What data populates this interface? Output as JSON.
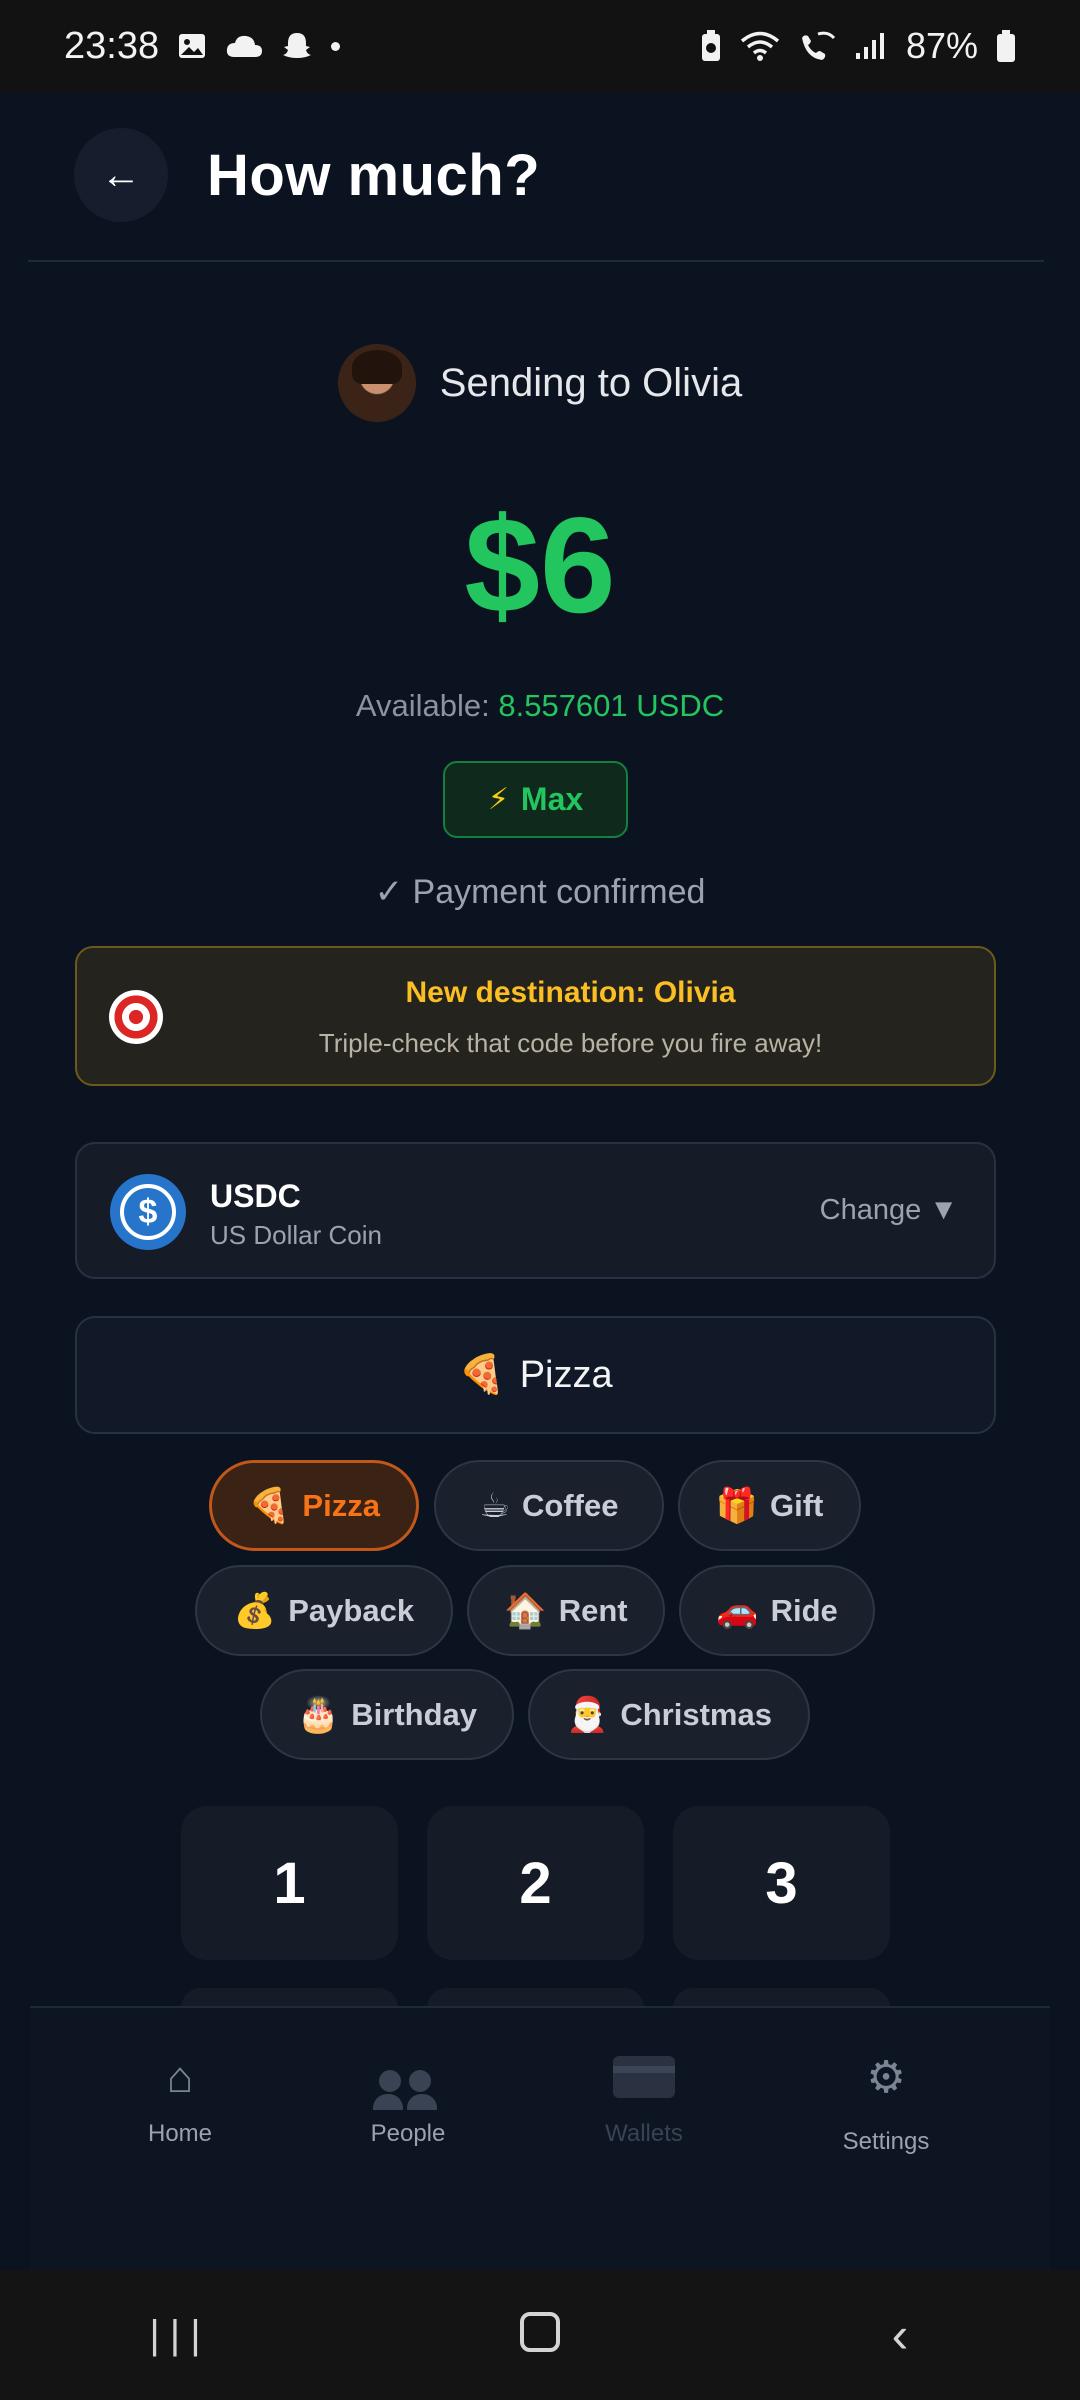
{
  "status_bar": {
    "time": "23:38",
    "battery": "87%",
    "left_icons": [
      "gallery-icon",
      "cloud-icon",
      "snapchat-icon",
      "dot-icon"
    ],
    "right_icons": [
      "battery-saver-icon",
      "wifi-icon",
      "wifi-calling-icon",
      "signal-icon",
      "battery-icon"
    ]
  },
  "header": {
    "back_icon": "←",
    "title": "How much?"
  },
  "recipient": {
    "label": "Sending to Olivia"
  },
  "amount": {
    "value": "$6",
    "available_label": "Available:",
    "available_value": "8.557601 USDC",
    "max_label": "Max",
    "max_icon": "⚡",
    "confirmed_text": "✓ Payment confirmed",
    "accent_color": "#22c55e"
  },
  "banner": {
    "icon": "target-icon",
    "title": "New destination: Olivia",
    "subtitle": "Triple-check that code before you fire away!"
  },
  "token": {
    "symbol": "USDC",
    "name": "US Dollar Coin",
    "change_label": "Change ▼",
    "icon_glyph": "$"
  },
  "note": {
    "emoji": "🍕",
    "value": "Pizza"
  },
  "categories": [
    {
      "emoji": "🍕",
      "label": "Pizza",
      "active": true
    },
    {
      "emoji": "☕",
      "label": "Coffee",
      "active": false
    },
    {
      "emoji": "🎁",
      "label": "Gift",
      "active": false
    },
    {
      "emoji": "💰",
      "label": "Payback",
      "active": false
    },
    {
      "emoji": "🏠",
      "label": "Rent",
      "active": false
    },
    {
      "emoji": "🚗",
      "label": "Ride",
      "active": false
    },
    {
      "emoji": "🎂",
      "label": "Birthday",
      "active": false
    },
    {
      "emoji": "🎅",
      "label": "Christmas",
      "active": false
    }
  ],
  "keypad": {
    "keys": [
      "1",
      "2",
      "3"
    ]
  },
  "bottom_nav": {
    "items": [
      {
        "label": "Home",
        "icon": "⌂"
      },
      {
        "label": "People",
        "icon": "people-icon"
      },
      {
        "label": "Wallets",
        "icon": "wallet-icon"
      },
      {
        "label": "Settings",
        "icon": "⚙"
      }
    ]
  },
  "system_nav": {
    "recent": "|||",
    "back": "‹"
  }
}
